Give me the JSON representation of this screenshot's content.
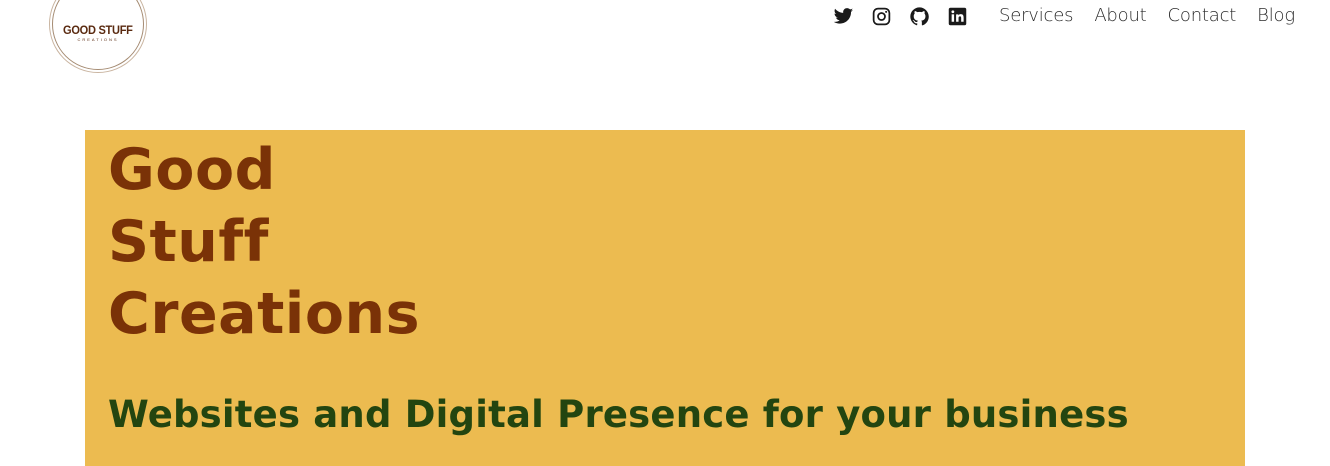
{
  "header": {
    "logo": {
      "main": "GOOD STUFF",
      "sub": "CREATIONS"
    },
    "social": [
      {
        "name": "twitter-icon",
        "icon": "twitter"
      },
      {
        "name": "instagram-icon",
        "icon": "instagram"
      },
      {
        "name": "github-icon",
        "icon": "github"
      },
      {
        "name": "linkedin-icon",
        "icon": "linkedin"
      }
    ],
    "nav": {
      "services": "Services",
      "about": "About",
      "contact": "Contact",
      "blog": "Blog"
    }
  },
  "hero": {
    "title_line1": "Good",
    "title_line2": "Stuff",
    "title_line3": "Creations",
    "subtitle": "Websites and Digital Presence for your business"
  },
  "colors": {
    "hero_background": "#ecbb50",
    "title": "#7a3207",
    "subtitle": "#234510",
    "icon": "#1a1a1a"
  }
}
